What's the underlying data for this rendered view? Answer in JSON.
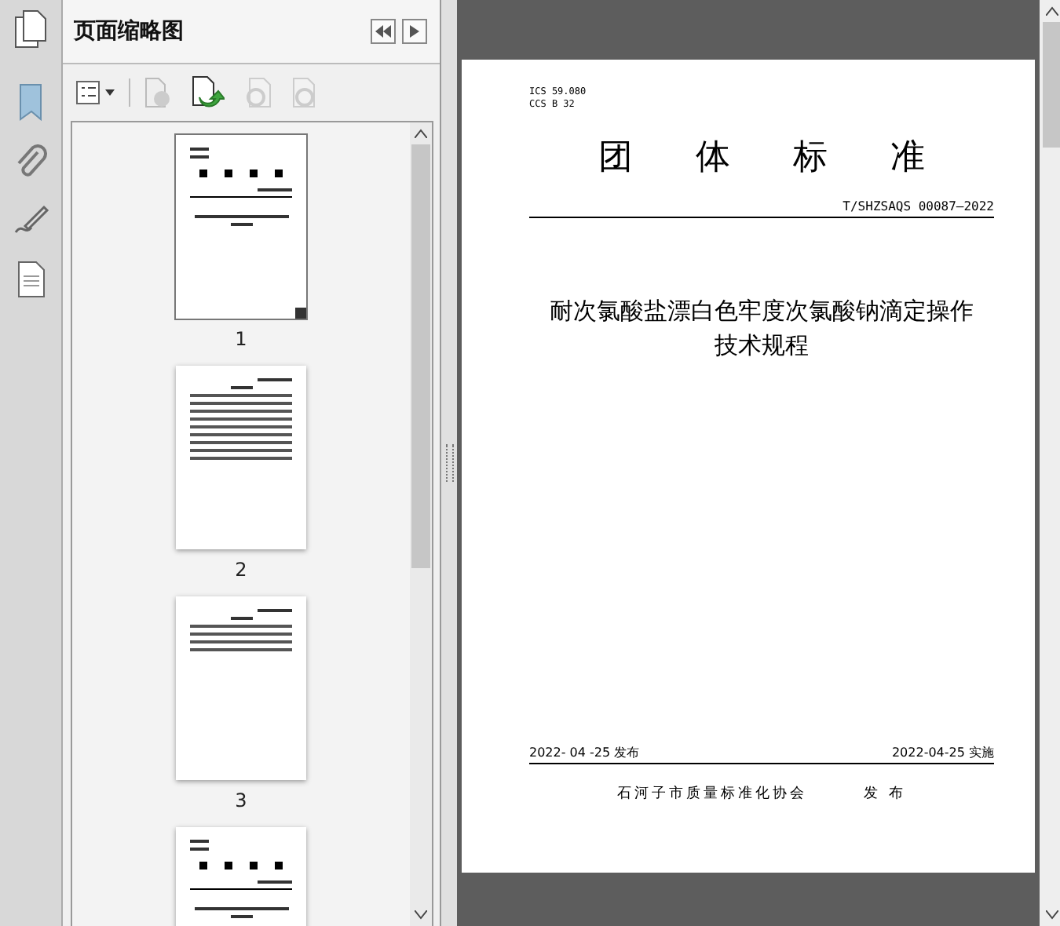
{
  "panel": {
    "title": "页面缩略图"
  },
  "thumbnails": [
    {
      "label": "1",
      "selected": true
    },
    {
      "label": "2",
      "selected": false
    },
    {
      "label": "3",
      "selected": false
    },
    {
      "selected": false
    }
  ],
  "document": {
    "classification": [
      "ICS 59.080",
      "CCS B 32"
    ],
    "heading": "团体标准",
    "code": "T/SHZSAQS 00087—2022",
    "title": "耐次氯酸盐漂白色牢度次氯酸钠滴定操作技术规程",
    "issue_date": "2022- 04 -25 发布",
    "effective_date": "2022-04-25 实施",
    "publisher": "石河子市质量标准化协会",
    "publish_label": "发 布"
  }
}
